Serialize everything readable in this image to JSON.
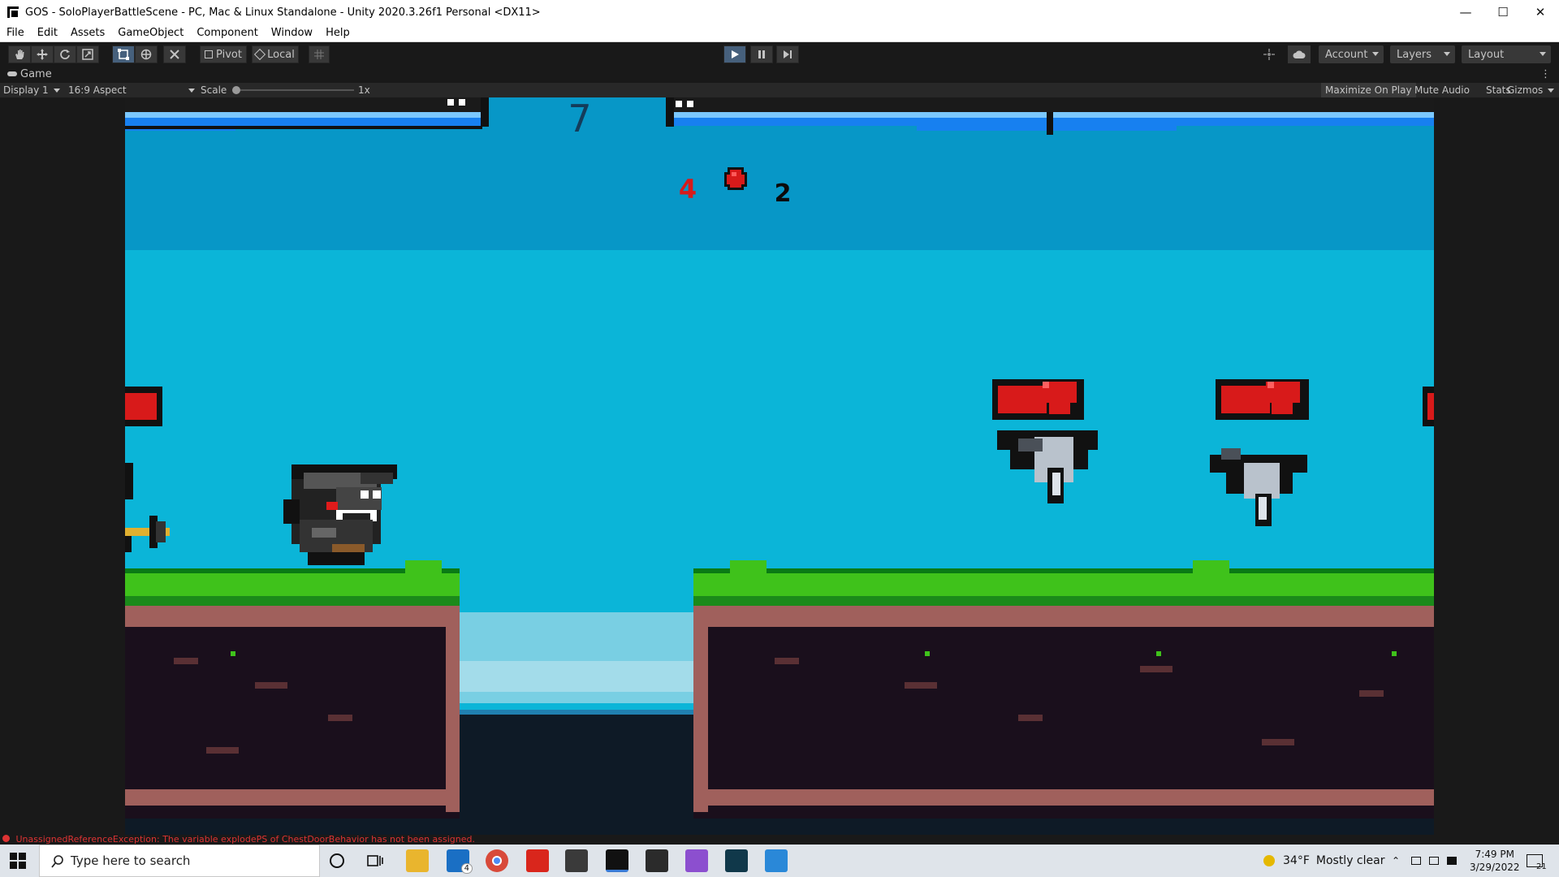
{
  "window": {
    "title": "GOS - SoloPlayerBattleScene - PC, Mac & Linux Standalone - Unity 2020.3.26f1 Personal <DX11>",
    "minimize_icon": "minimize-icon",
    "maximize_icon": "maximize-icon",
    "close_icon": "close-icon"
  },
  "menu": [
    "File",
    "Edit",
    "Assets",
    "GameObject",
    "Component",
    "Window",
    "Help"
  ],
  "toolbar": {
    "pivot_label": "Pivot",
    "local_label": "Local",
    "account_label": "Account",
    "layers_label": "Layers",
    "layout_label": "Layout"
  },
  "game_tab": {
    "label": "Game"
  },
  "game_bar": {
    "display": "Display 1",
    "aspect": "16:9 Aspect",
    "scale_label": "Scale",
    "scale_value": "1x",
    "maximize_on_play": "Maximize On Play",
    "mute_audio": "Mute Audio",
    "stats": "Stats",
    "gizmos": "Gizmos"
  },
  "game": {
    "timer": "7",
    "score_left": "4",
    "score_right": "2",
    "colors": {
      "sky_top": "#0797c7",
      "sky": "#0bb5d8",
      "bar_blue": "#1780f0",
      "grass": "#3fc21b",
      "dirt": "#a0605c",
      "earth": "#1a0f1c",
      "health_red": "#d81a1a"
    }
  },
  "error": {
    "message": "UnassignedReferenceException: The variable explodePS of ChestDoorBehavior has not been assigned."
  },
  "taskbar": {
    "search_placeholder": "Type here to search",
    "mail_badge": "4",
    "temperature": "34°F",
    "weather": "Mostly clear",
    "time": "7:49 PM",
    "date": "3/29/2022",
    "notification_count": "21"
  }
}
